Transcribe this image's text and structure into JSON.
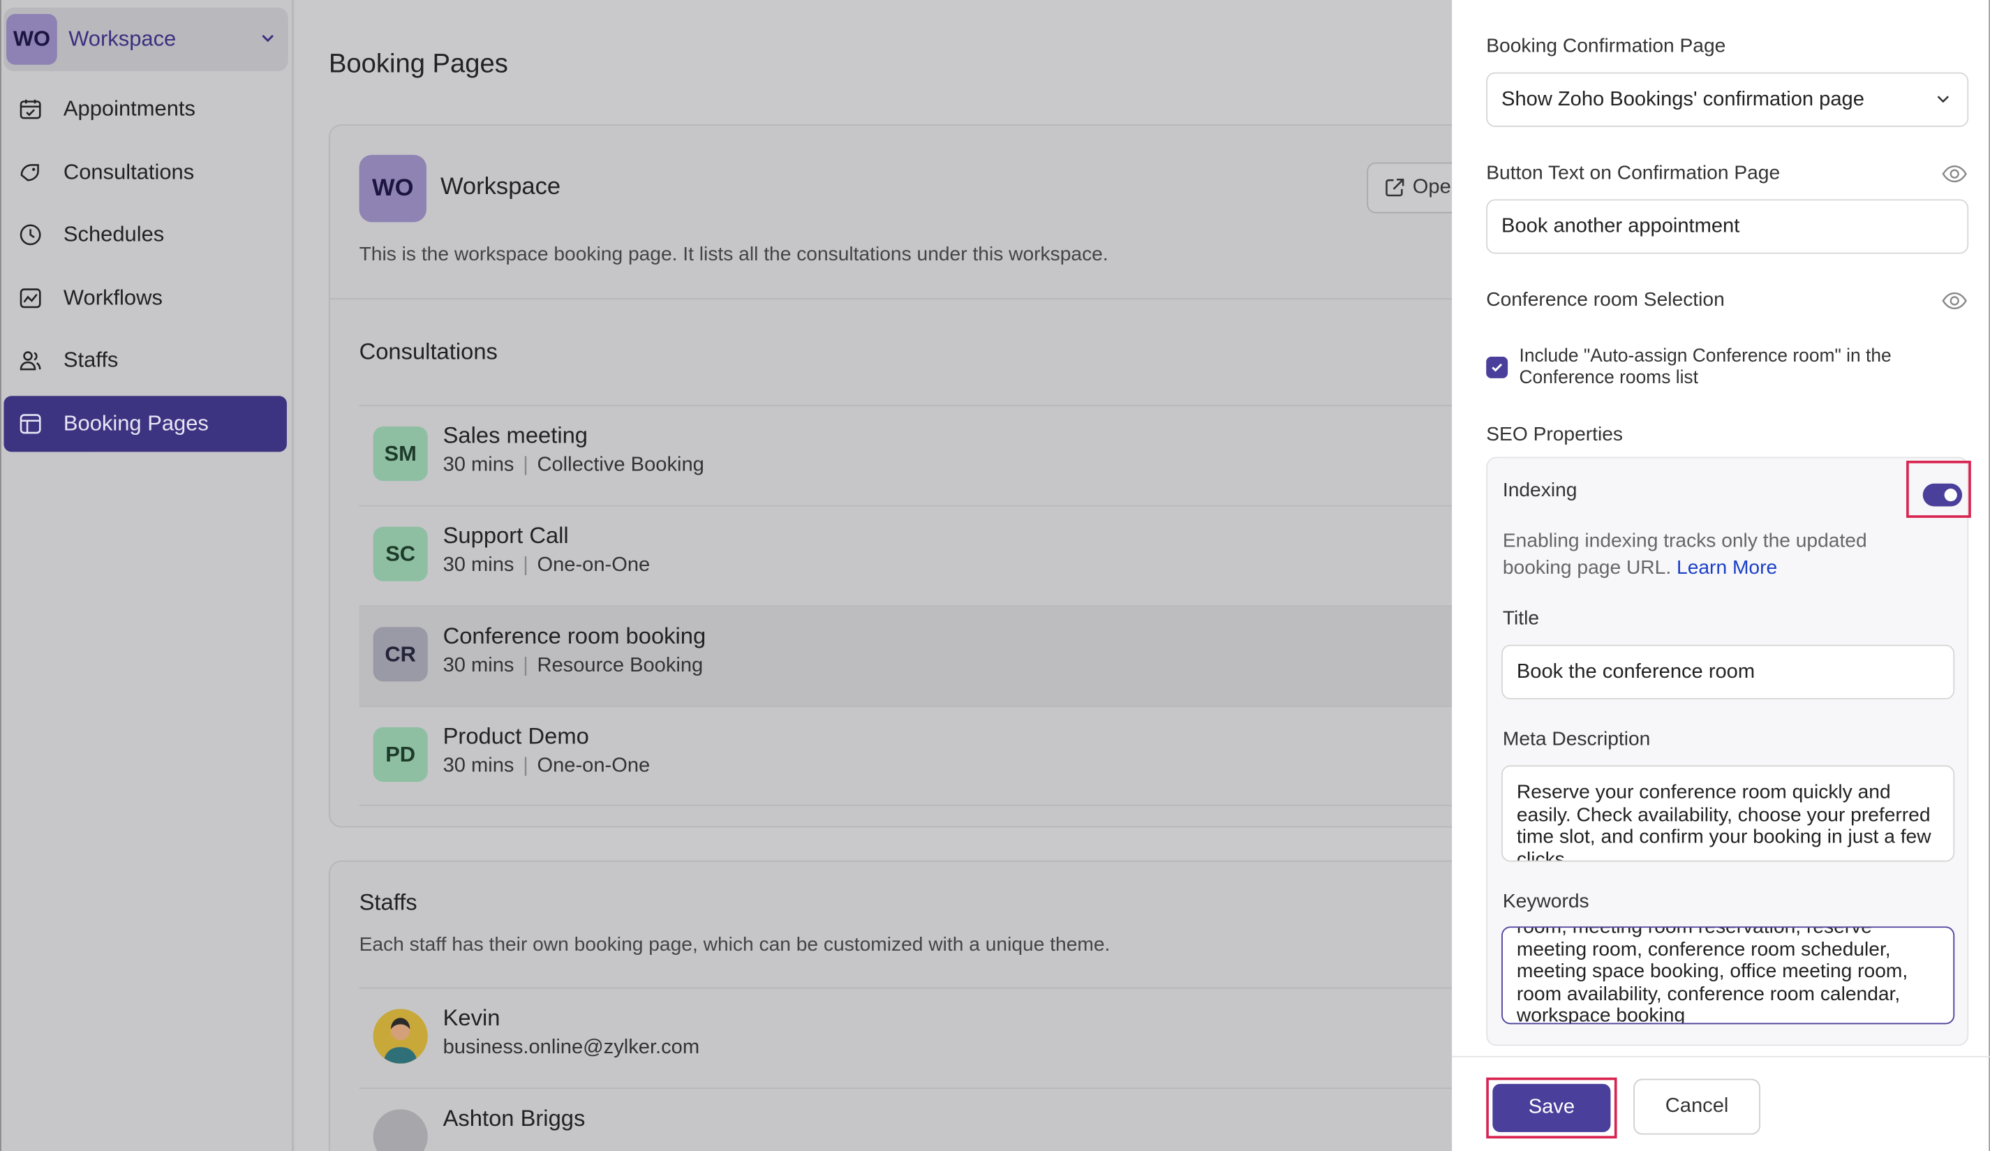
{
  "sidebar": {
    "workspace_badge": "WO",
    "workspace_name": "Workspace",
    "items": [
      {
        "label": "Appointments",
        "icon": "calendar-check-icon"
      },
      {
        "label": "Consultations",
        "icon": "tag-icon"
      },
      {
        "label": "Schedules",
        "icon": "clock-icon"
      },
      {
        "label": "Workflows",
        "icon": "workflow-icon"
      },
      {
        "label": "Staffs",
        "icon": "users-icon"
      },
      {
        "label": "Booking Pages",
        "icon": "layout-icon"
      }
    ],
    "active_item": "Booking Pages"
  },
  "main": {
    "title": "Booking Pages",
    "workspace_card": {
      "badge": "WO",
      "name": "Workspace",
      "open_label": "Open",
      "description": "This is the workspace booking page. It lists all the consultations under this workspace."
    },
    "consultations_title": "Consultations",
    "consultations": [
      {
        "initials": "SM",
        "name": "Sales meeting",
        "duration": "30 mins",
        "type": "Collective Booking"
      },
      {
        "initials": "SC",
        "name": "Support Call",
        "duration": "30 mins",
        "type": "One-on-One"
      },
      {
        "initials": "CR",
        "name": "Conference room booking",
        "duration": "30 mins",
        "type": "Resource Booking"
      },
      {
        "initials": "PD",
        "name": "Product Demo",
        "duration": "30 mins",
        "type": "One-on-One"
      }
    ],
    "staffs_title": "Staffs",
    "staffs_description": "Each staff has their own booking page, which can be customized with a unique theme.",
    "staffs": [
      {
        "name": "Kevin",
        "email": "business.online@zylker.com"
      },
      {
        "name": "Ashton Briggs",
        "email": ""
      }
    ]
  },
  "panel": {
    "confirmation_page_label": "Booking Confirmation Page",
    "confirmation_page_value": "Show Zoho Bookings' confirmation page",
    "button_text_label": "Button Text on Confirmation Page",
    "button_text_value": "Book another appointment",
    "conference_room_label": "Conference room Selection",
    "auto_assign_text": "Include \"Auto-assign Conference room\" in the Conference rooms list",
    "auto_assign_checked": true,
    "seo_label": "SEO Properties",
    "indexing_label": "Indexing",
    "indexing_enabled": true,
    "indexing_desc": "Enabling indexing tracks only the updated booking page URL.",
    "learn_more": "Learn More",
    "title_label": "Title",
    "title_value": "Book the conference room",
    "meta_label": "Meta Description",
    "meta_value": "Reserve your conference room quickly and easily. Check availability, choose your preferred time slot, and confirm your booking in just a few clicks.",
    "keywords_label": "Keywords",
    "keywords_value": "room, meeting room reservation, reserve meeting room, conference room scheduler, meeting space booking, office meeting room, room availability, conference room calendar, workspace booking",
    "save_label": "Save",
    "cancel_label": "Cancel"
  },
  "colors": {
    "accent": "#4a3f9a",
    "highlight_border": "#d8234f"
  }
}
